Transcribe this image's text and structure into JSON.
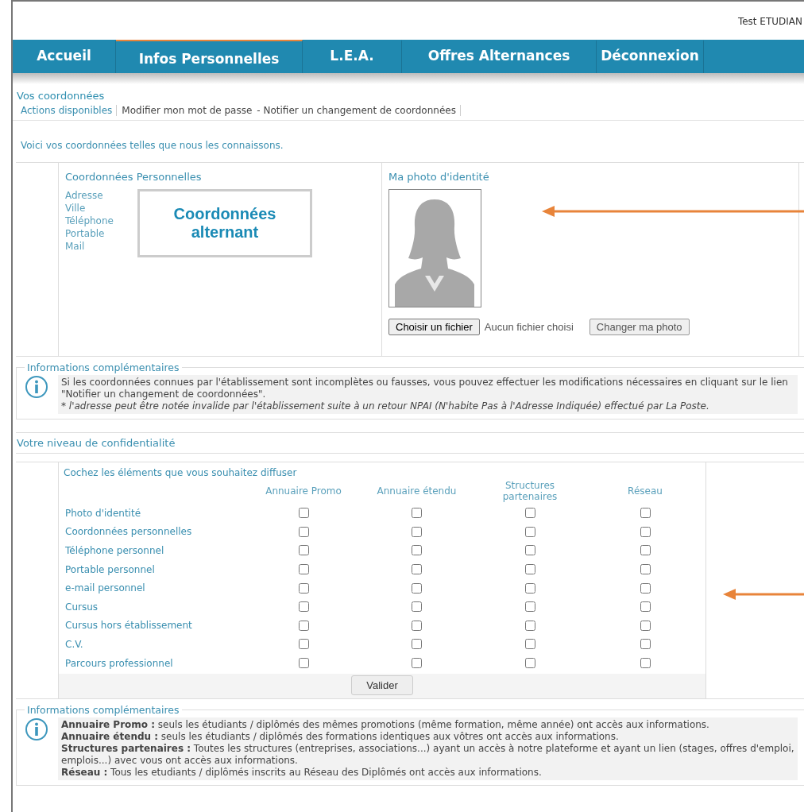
{
  "user": "Test ETUDIAN",
  "nav": [
    {
      "label": "Accueil",
      "selected": false
    },
    {
      "label": "Infos Personnelles",
      "selected": true
    },
    {
      "label": "L.E.A.",
      "selected": false
    },
    {
      "label": "Offres Alternances",
      "selected": false
    },
    {
      "label": "Déconnexion",
      "selected": false
    }
  ],
  "coordonnees": {
    "title": "Vos coordonnées",
    "actions_label": "Actions disponibles",
    "actions": [
      "Modifier mon mot de passe",
      "- Notifier un changement de coordonnées"
    ],
    "intro": "Voici vos coordonnées telles que nous les connaissons.",
    "personal": {
      "title": "Coordonnées Personnelles",
      "fields": [
        "Adresse",
        "Ville",
        "Téléphone",
        "Portable",
        "Mail"
      ],
      "callout": "Coordonnées alternant"
    },
    "photo": {
      "title": "Ma photo d'identité",
      "file_button": "Choisir un fichier",
      "file_status": "Aucun fichier choisi",
      "submit": "Changer ma photo"
    },
    "info": {
      "legend": "Informations complémentaires",
      "lines": [
        "Si les coordonnées connues par l'établissement sont incomplètes ou fausses, vous pouvez effectuer les modifications nécessaires en cliquant sur le lien \"Notifier un changement de coordonnées\".",
        "* l'adresse peut être notée invalide par l'établissement suite à un retour NPAI (N'habite Pas à l'Adresse Indiquée) effectué par La Poste."
      ]
    }
  },
  "privacy": {
    "title": "Votre niveau de confidentialité",
    "instruction": "Cochez les éléments que vous souhaitez diffuser",
    "columns": [
      "Annuaire Promo",
      "Annuaire étendu",
      "Structures partenaires",
      "Réseau"
    ],
    "rows": [
      {
        "label": "Photo d'identité",
        "checked": [
          false,
          false,
          false,
          false
        ]
      },
      {
        "label": "Coordonnées personnelles",
        "checked": [
          false,
          false,
          false,
          false
        ]
      },
      {
        "label": "Téléphone personnel",
        "checked": [
          false,
          false,
          false,
          false
        ]
      },
      {
        "label": "Portable personnel",
        "checked": [
          false,
          false,
          false,
          false
        ]
      },
      {
        "label": "e-mail personnel",
        "checked": [
          false,
          false,
          false,
          false
        ]
      },
      {
        "label": "Cursus",
        "checked": [
          false,
          false,
          false,
          false
        ]
      },
      {
        "label": "Cursus hors établissement",
        "checked": [
          false,
          false,
          false,
          false
        ]
      },
      {
        "label": "C.V.",
        "checked": [
          false,
          false,
          false,
          false
        ]
      },
      {
        "label": "Parcours professionnel",
        "checked": [
          false,
          false,
          false,
          false
        ]
      }
    ],
    "submit": "Valider",
    "info": {
      "legend": "Informations complémentaires",
      "lines": [
        "**Annuaire Promo :** seuls les étudiants / diplômés des mêmes promotions (même formation, même année) ont accès aux informations.",
        "**Annuaire étendu :** seuls les étudiants / diplômés des formations identiques aux vôtres ont accès aux informations.",
        "**Structures partenaires :** Toutes les structures (entreprises, associations...) ayant un accès à notre plateforme et ayant un lien (stages, offres d'emploi, emplois...) avec vous ont accès aux informations.",
        "**Réseau :** Tous les etudiants / diplômés inscrits au Réseau des Diplômés ont accès aux informations."
      ]
    }
  }
}
